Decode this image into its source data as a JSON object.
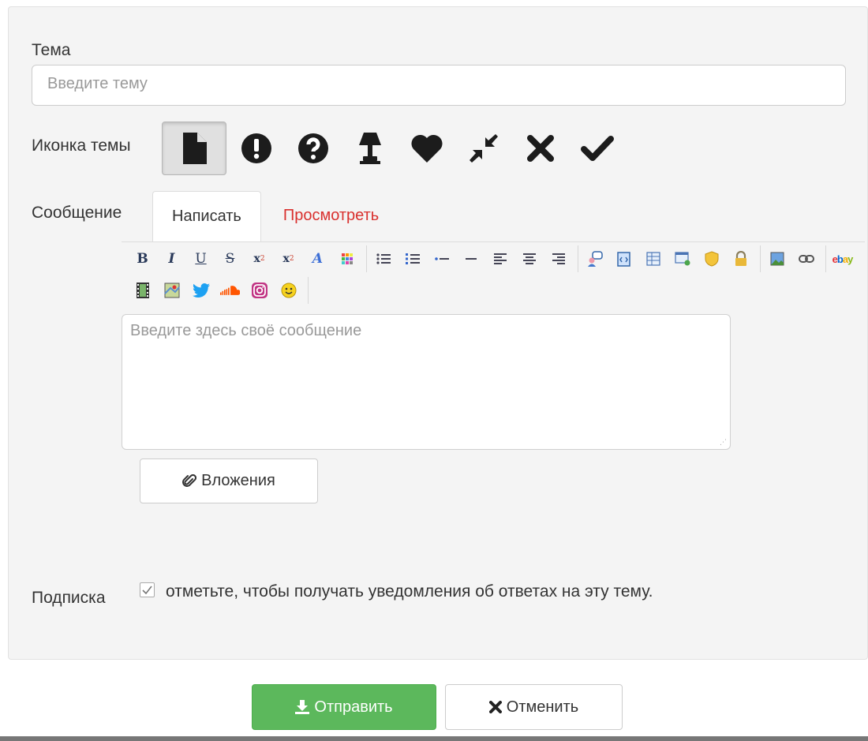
{
  "subject": {
    "label": "Тема",
    "placeholder": "Введите тему"
  },
  "topic_icon": {
    "label": "Иконка темы",
    "icons": [
      "file-icon",
      "exclamation-circle-icon",
      "question-circle-icon",
      "lamp-icon",
      "heart-icon",
      "compress-icon",
      "times-icon",
      "check-icon"
    ],
    "selected": "file-icon"
  },
  "message": {
    "label": "Сообщение",
    "tabs": [
      {
        "label": "Написать",
        "active": true
      },
      {
        "label": "Просмотреть",
        "active": false
      }
    ],
    "toolbar_row1": [
      "bold-icon",
      "italic-icon",
      "underline-icon",
      "strikethrough-icon",
      "subscript-icon",
      "superscript-icon",
      "font-icon",
      "color-icon",
      "|",
      "bullet-list-icon",
      "numbered-list-icon",
      "list-item-icon",
      "horizontal-rule-icon",
      "align-left-icon",
      "align-center-icon",
      "align-right-icon",
      "|",
      "quote-icon",
      "code-icon",
      "table-icon",
      "module-icon",
      "hide-icon",
      "confidential-icon",
      "|",
      "image-icon",
      "link-icon",
      "|",
      "ebay-icon"
    ],
    "toolbar_row2": [
      "video-icon",
      "map-icon",
      "twitter-icon",
      "soundcloud-icon",
      "instagram-icon",
      "smiley-icon"
    ],
    "placeholder": "Введите здесь своё сообщение"
  },
  "attachments": {
    "label": "Вложения"
  },
  "subscription": {
    "label": "Подписка",
    "text": "отметьте, чтобы получать уведомления об ответах на эту тему.",
    "checked": true
  },
  "actions": {
    "submit": "Отправить",
    "cancel": "Отменить"
  },
  "colors": {
    "submit_bg": "#5cb85c",
    "preview_tab": "#d9302e",
    "panel_bg": "#f4f4f4"
  }
}
